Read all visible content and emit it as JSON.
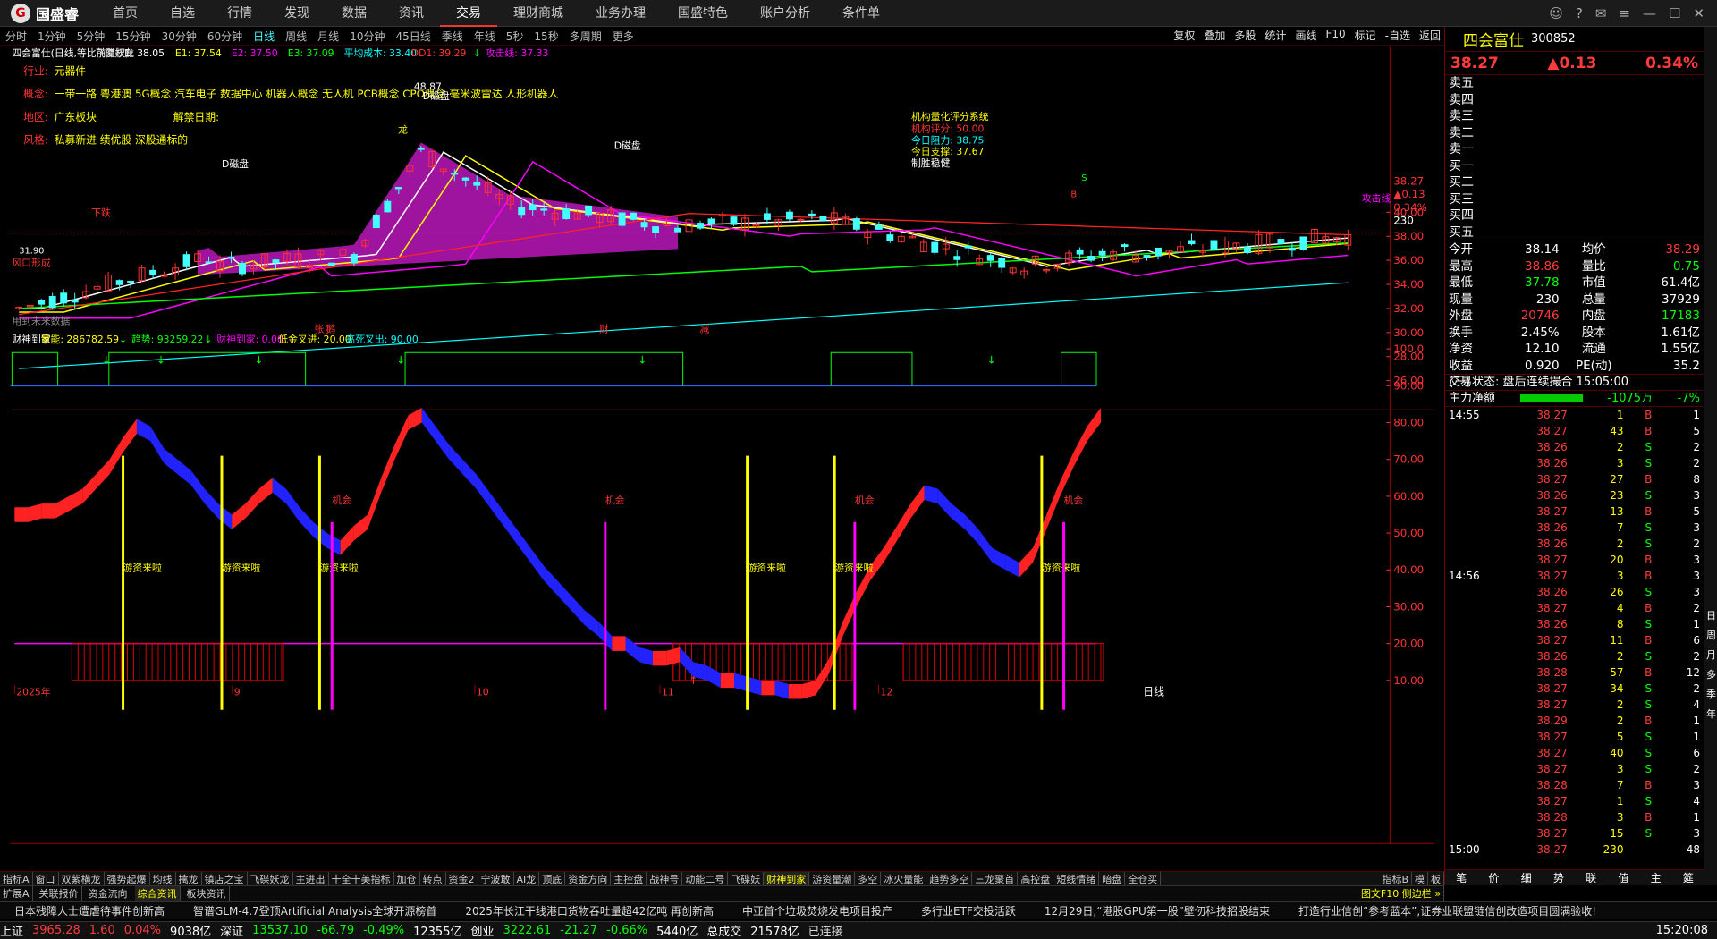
{
  "app": {
    "logo": "国盛睿",
    "logo_mark": "G"
  },
  "menu": [
    "首页",
    "自选",
    "行情",
    "发现",
    "数据",
    "资讯",
    "交易",
    "理财商城",
    "业务办理",
    "国盛特色",
    "账户分析",
    "条件单"
  ],
  "menu_active": 6,
  "periods": [
    "分时",
    "1分钟",
    "5分钟",
    "15分钟",
    "30分钟",
    "60分钟",
    "日线",
    "周线",
    "月线",
    "10分钟",
    "45日线",
    "季线",
    "年线",
    "5秒",
    "15秒",
    "多周期",
    "更多"
  ],
  "period_active": 6,
  "chart_tools": [
    "复权",
    "叠加",
    "多股",
    "统计",
    "画线",
    "F10",
    "标记",
    "-自选",
    "返回"
  ],
  "main_legend": [
    {
      "t": "四会富仕(日线,等比前复权)",
      "c": "#fff"
    },
    {
      "t": "飞碟妖龙",
      "c": "#ddd"
    },
    {
      "t": "E: 38.05",
      "c": "#fff"
    },
    {
      "t": "E1: 37.54",
      "c": "#ff0"
    },
    {
      "t": "E2: 37.50",
      "c": "#f0f"
    },
    {
      "t": "E3: 37.09",
      "c": "#0f0"
    },
    {
      "t": "平均成本: 33.40",
      "c": "#0ff"
    },
    {
      "t": "DD1: 39.29",
      "c": "#f33"
    },
    {
      "t": "↓",
      "c": "#0f0"
    },
    {
      "t": "攻击线: 37.33",
      "c": "#f0f"
    }
  ],
  "info": {
    "industry_label": "行业:",
    "industry": "元器件",
    "concept_label": "概念:",
    "concept": "一带一路 粤港澳 5G概念 汽车电子 数据中心 机器人概念 无人机 PCB概念 CPO概念 毫米波雷达 人形机器人",
    "region_label": "地区:",
    "region": "广东板块",
    "unlock_label": "解禁日期:",
    "style_label": "风格:",
    "style": "私募新进 绩优股 深股通标的"
  },
  "score": {
    "title": "机构量化评分系统",
    "rows": [
      "机构评分: 50.00",
      "今日阻力: 38.75",
      "今日支撑: 37.67",
      "制胜稳健"
    ]
  },
  "annotations": {
    "dpan": "D磁盘",
    "peak": "48.87",
    "low": "31.90",
    "windows": "风口形成",
    "attack": "攻击线",
    "dragon": "龙",
    "down": "下跌",
    "future": "用到未来数据",
    "top_marks": [
      "张",
      "鹅",
      "财",
      "减"
    ],
    "buy": "S",
    "b": "B"
  },
  "yaxis_main": [
    "40.00",
    "38.00",
    "36.00",
    "34.00",
    "32.00",
    "30.00",
    "28.00",
    "26.00"
  ],
  "price_tags": {
    "last": "38.27",
    "chg": "▲0.13",
    "pct": "0.34%",
    "vol": "230"
  },
  "sub_legend": [
    {
      "t": "财神到家",
      "c": "#fff"
    },
    {
      "t": "量能: 286782.59",
      "c": "#ff0"
    },
    {
      "t": "↓",
      "c": "#0f0"
    },
    {
      "t": "趋势: 93259.22",
      "c": "#0f0"
    },
    {
      "t": "↓",
      "c": "#0f0"
    },
    {
      "t": "财神到家: 0.00",
      "c": "#f0f"
    },
    {
      "t": "低金叉进: 20.00",
      "c": "#ff0"
    },
    {
      "t": "高死叉出: 90.00",
      "c": "#0ff"
    }
  ],
  "yaxis_sub": [
    "100.0",
    "90.00",
    "80.00",
    "70.00",
    "60.00",
    "50.00",
    "40.00",
    "30.00",
    "20.00",
    "10.00"
  ],
  "sub_labels": {
    "fund": "游资来啦",
    "chance": "机会"
  },
  "xaxis": [
    "2025年",
    "9",
    "10",
    "11",
    "12"
  ],
  "xaxis_right": "日线",
  "bottom_tabs": [
    "指标A",
    "窗口",
    "双紫横龙",
    "强势起爆",
    "均线",
    "擒龙",
    "镇店之宝",
    "飞碟妖龙",
    "主进出",
    "十全十美指标",
    "加仓",
    "转点",
    "资金2",
    "宁波敢",
    "AI龙",
    "顶底",
    "资金方向",
    "主控盘",
    "战神号",
    "动能二号",
    "飞碟妖",
    "财神到家",
    "游资量潮",
    "多空",
    "冰火量能",
    "趋势多空",
    "三龙聚首",
    "高控盘",
    "短线情绪",
    "暗盘",
    "全仓买"
  ],
  "bottom_tab_active": 21,
  "bottom_tab_right": [
    "指标B",
    "模",
    "板"
  ],
  "bottom_left_tabs": [
    "扩展A",
    "关联报价",
    "资金流向",
    "综合资讯",
    "板块资讯"
  ],
  "bottom_left_active": 3,
  "bottom_right": "图文F10 侧边栏 »",
  "stock": {
    "name": "四会富仕",
    "code": "300852",
    "price": "38.27",
    "chg": "▲0.13",
    "pct": "0.34%"
  },
  "orderbook": [
    "卖五",
    "卖四",
    "卖三",
    "卖二",
    "卖一",
    "买一",
    "买二",
    "买三",
    "买四",
    "买五"
  ],
  "quotes": [
    [
      "今开",
      "38.14",
      "均价",
      "38.29"
    ],
    [
      "最高",
      "38.86",
      "量比",
      "0.75"
    ],
    [
      "最低",
      "37.78",
      "市值",
      "61.4亿"
    ],
    [
      "现量",
      "230",
      "总量",
      "37929"
    ],
    [
      "外盘",
      "20746",
      "内盘",
      "17183"
    ],
    [
      "换手",
      "2.45%",
      "股本",
      "1.61亿"
    ],
    [
      "净资",
      "12.10",
      "流通",
      "1.55亿"
    ],
    [
      "收益(三)",
      "0.920",
      "PE(动)",
      "35.2"
    ]
  ],
  "status_line": "交易状态: 盘后连续撮合 15:05:00",
  "net_flow": {
    "label": "主力净额",
    "value": "-1075万",
    "pct": "-7%"
  },
  "trades": [
    [
      "14:55",
      "38.27",
      "1",
      "B",
      "1"
    ],
    [
      "",
      "38.27",
      "43",
      "B",
      "5"
    ],
    [
      "",
      "38.26",
      "2",
      "S",
      "2"
    ],
    [
      "",
      "38.26",
      "3",
      "S",
      "2"
    ],
    [
      "",
      "38.27",
      "27",
      "B",
      "8"
    ],
    [
      "",
      "38.26",
      "23",
      "S",
      "3"
    ],
    [
      "",
      "38.27",
      "13",
      "B",
      "5"
    ],
    [
      "",
      "38.26",
      "7",
      "S",
      "3"
    ],
    [
      "",
      "38.26",
      "2",
      "S",
      "2"
    ],
    [
      "",
      "38.27",
      "20",
      "B",
      "3"
    ],
    [
      "14:56",
      "38.27",
      "3",
      "B",
      "3"
    ],
    [
      "",
      "38.26",
      "26",
      "S",
      "3"
    ],
    [
      "",
      "38.27",
      "4",
      "B",
      "2"
    ],
    [
      "",
      "38.26",
      "8",
      "S",
      "1"
    ],
    [
      "",
      "38.27",
      "11",
      "B",
      "6"
    ],
    [
      "",
      "38.26",
      "2",
      "S",
      "2"
    ],
    [
      "",
      "38.28",
      "57",
      "B",
      "12"
    ],
    [
      "",
      "38.27",
      "34",
      "S",
      "2"
    ],
    [
      "",
      "38.27",
      "2",
      "S",
      "4"
    ],
    [
      "",
      "38.29",
      "2",
      "B",
      "1"
    ],
    [
      "",
      "38.27",
      "5",
      "S",
      "1"
    ],
    [
      "",
      "38.27",
      "40",
      "S",
      "6"
    ],
    [
      "",
      "38.27",
      "3",
      "S",
      "2"
    ],
    [
      "",
      "38.28",
      "7",
      "B",
      "3"
    ],
    [
      "",
      "38.27",
      "1",
      "S",
      "4"
    ],
    [
      "",
      "38.28",
      "3",
      "B",
      "1"
    ],
    [
      "",
      "38.27",
      "15",
      "S",
      "3"
    ],
    [
      "15:00",
      "38.27",
      "230",
      "",
      "48"
    ]
  ],
  "side_strip": [
    "日",
    "周",
    "月",
    "多",
    "季",
    "年"
  ],
  "bottom_side_tabs": [
    "笔",
    "价",
    "细",
    "势",
    "联",
    "值",
    "主",
    "筵"
  ],
  "news": [
    "日本残障人士遭虐待事件创新高",
    "智谱GLM-4.7登顶Artificial Analysis全球开源榜首",
    "2025年长江干线港口货物吞吐量超42亿吨 再创新高",
    "中亚首个垃圾焚烧发电项目投产",
    "多行业ETF交投活跃",
    "12月29日,“港股GPU第一股”壁仞科技招股结束",
    "打造行业信创“参考蓝本”,证券业联盟链信创改造项目圆满验收!"
  ],
  "status": [
    {
      "t": "上证",
      "c": "#fff"
    },
    {
      "t": "3965.28",
      "c": "#ff3b3b"
    },
    {
      "t": "1.60",
      "c": "#ff3b3b"
    },
    {
      "t": "0.04%",
      "c": "#ff3b3b"
    },
    {
      "t": "9038亿",
      "c": "#fff"
    },
    {
      "t": "深证",
      "c": "#fff"
    },
    {
      "t": "13537.10",
      "c": "#0f0"
    },
    {
      "t": "-66.79",
      "c": "#0f0"
    },
    {
      "t": "-0.49%",
      "c": "#0f0"
    },
    {
      "t": "12355亿",
      "c": "#fff"
    },
    {
      "t": "创业",
      "c": "#fff"
    },
    {
      "t": "3222.61",
      "c": "#0f0"
    },
    {
      "t": "-21.27",
      "c": "#0f0"
    },
    {
      "t": "-0.66%",
      "c": "#0f0"
    },
    {
      "t": "5440亿",
      "c": "#fff"
    },
    {
      "t": "总成交",
      "c": "#fff"
    },
    {
      "t": "21578亿",
      "c": "#fff"
    },
    {
      "t": "已连接",
      "c": "#ddd"
    }
  ],
  "clock": "15:20:08"
}
